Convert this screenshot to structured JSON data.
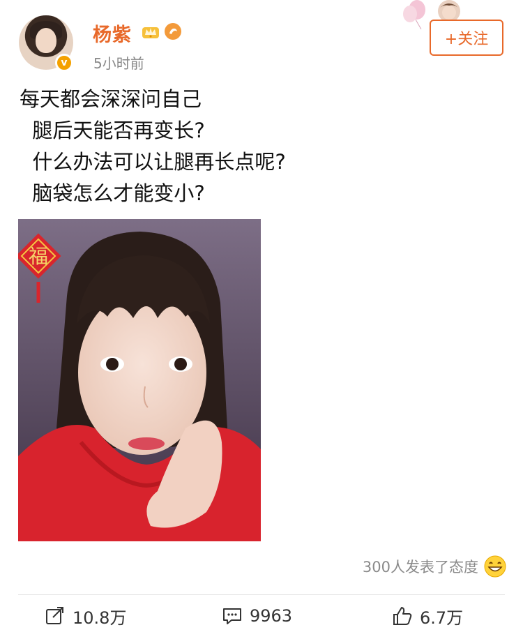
{
  "post": {
    "author": "杨紫",
    "time": "5小时前",
    "follow_label": "+关注",
    "text_lines": [
      "每天都会深深问自己",
      "  腿后天能否再变长?",
      "  什么办法可以让腿再长点呢?",
      "  脑袋怎么才能变小?"
    ],
    "reactions_text": "300人发表了态度"
  },
  "toolbar": {
    "repost_count": "10.8万",
    "comment_count": "9963",
    "like_count": "6.7万"
  },
  "photo": {
    "sticker_text": "福"
  },
  "icons": {
    "verified": "verified-badge-icon",
    "crown": "crown-icon",
    "badge": "member-badge-icon",
    "smiley": "smiley-icon",
    "repost": "repost-icon",
    "comment": "comment-icon",
    "like": "thumbs-up-icon"
  },
  "colors": {
    "accent": "#e8692a",
    "verified": "#f4a100",
    "muted": "#888888"
  }
}
